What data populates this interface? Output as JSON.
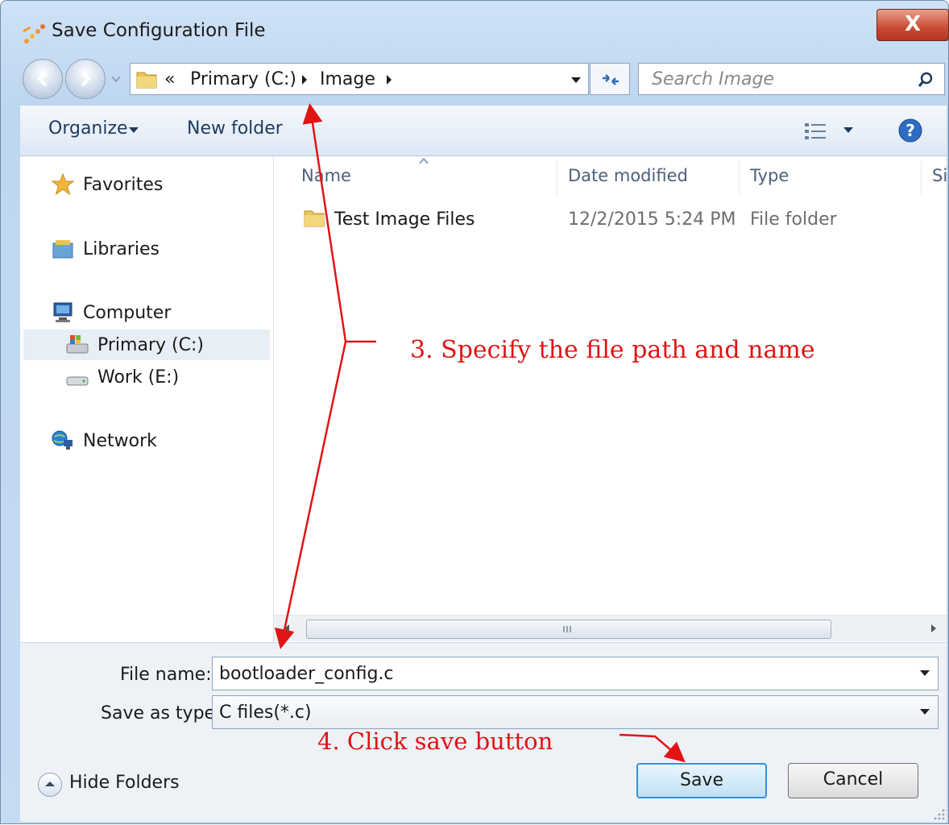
{
  "window": {
    "title": "Save Configuration File",
    "close_label": "X"
  },
  "address_bar": {
    "overflow_symbol": "«",
    "segments": [
      "Primary (C:)",
      "Image"
    ],
    "search_placeholder": "Search Image"
  },
  "toolbar": {
    "organize_label": "Organize",
    "new_folder_label": "New folder"
  },
  "nav_pane": {
    "items": [
      {
        "label": "Favorites",
        "icon": "star-icon"
      },
      {
        "label": "Libraries",
        "icon": "libraries-icon"
      },
      {
        "label": "Computer",
        "icon": "computer-icon"
      },
      {
        "label": "Primary (C:)",
        "icon": "drive-icon",
        "selected": true
      },
      {
        "label": "Work (E:)",
        "icon": "drive-icon"
      },
      {
        "label": "Network",
        "icon": "network-icon"
      }
    ]
  },
  "file_list": {
    "columns": [
      "Name",
      "Date modified",
      "Type",
      "Si"
    ],
    "rows": [
      {
        "name": "Test Image Files",
        "date_modified": "12/2/2015 5:24 PM",
        "type": "File folder"
      }
    ]
  },
  "form": {
    "file_name_label": "File name:",
    "file_name_value": "bootloader_config.c",
    "save_type_label": "Save as type:",
    "save_type_value": "C files(*.c)"
  },
  "buttons": {
    "save_label": "Save",
    "cancel_label": "Cancel",
    "hide_folders_label": "Hide Folders"
  },
  "annotations": {
    "step3": "3. Specify the file path and name",
    "step4": "4. Click save button",
    "color": "#e01414"
  },
  "colors": {
    "window_frame": "#bed6f0",
    "close_button": "#c94a33",
    "save_button_border": "#3c8fd6"
  }
}
